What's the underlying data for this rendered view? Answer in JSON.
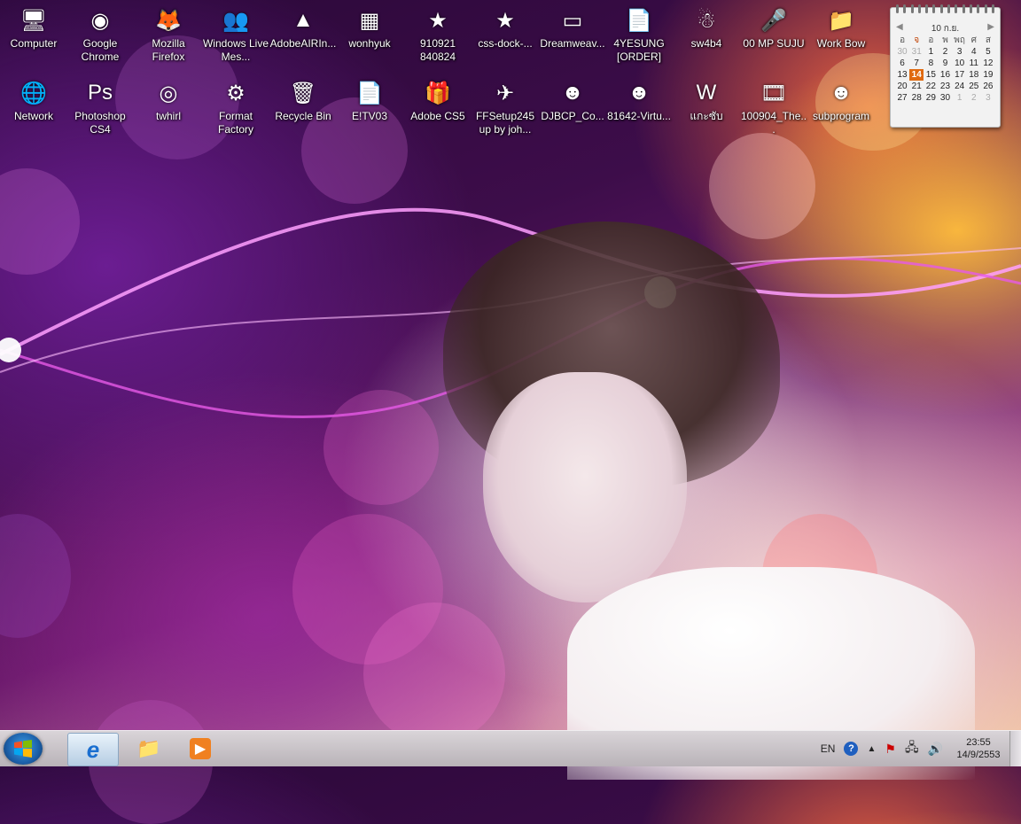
{
  "desktop": {
    "row1": [
      {
        "name": "icon-computer",
        "label": "Computer",
        "glyph": "🖥"
      },
      {
        "name": "icon-google-chrome",
        "label": "Google Chrome",
        "glyph": "◉"
      },
      {
        "name": "icon-mozilla-firefox",
        "label": "Mozilla Firefox",
        "glyph": "🦊"
      },
      {
        "name": "icon-windows-live-messenger",
        "label": "Windows Live Mes...",
        "glyph": "👥"
      },
      {
        "name": "icon-adobe-air",
        "label": "AdobeAIRIn...",
        "glyph": "▲"
      },
      {
        "name": "icon-wonhyuk",
        "label": "wonhyuk",
        "glyph": "▦"
      },
      {
        "name": "icon-910921",
        "label": "910921 840824",
        "glyph": "★"
      },
      {
        "name": "icon-css-dock",
        "label": "css-dock-...",
        "glyph": "★"
      },
      {
        "name": "icon-dreamweaver",
        "label": "Dreamweav...",
        "glyph": "▭"
      },
      {
        "name": "icon-4yesung-order",
        "label": "4YESUNG [ORDER]",
        "glyph": "📄"
      },
      {
        "name": "icon-sw4b4",
        "label": "sw4b4",
        "glyph": "☃"
      },
      {
        "name": "icon-00-mp-suju",
        "label": "00 MP SUJU",
        "glyph": "🎤"
      },
      {
        "name": "icon-work-bow",
        "label": "Work Bow",
        "glyph": "📁"
      }
    ],
    "row2": [
      {
        "name": "icon-network",
        "label": "Network",
        "glyph": "🌐"
      },
      {
        "name": "icon-photoshop-cs4",
        "label": "Photoshop CS4",
        "glyph": "Ps"
      },
      {
        "name": "icon-twhirl",
        "label": "twhirl",
        "glyph": "◎"
      },
      {
        "name": "icon-format-factory",
        "label": "Format Factory",
        "glyph": "⚙"
      },
      {
        "name": "icon-recycle-bin",
        "label": "Recycle Bin",
        "glyph": "🗑"
      },
      {
        "name": "icon-etv03",
        "label": "E!TV03",
        "glyph": "📄"
      },
      {
        "name": "icon-adobe-cs5",
        "label": "Adobe CS5",
        "glyph": "🎁"
      },
      {
        "name": "icon-ffsetup",
        "label": "FFSetup245 up by joh...",
        "glyph": "✈"
      },
      {
        "name": "icon-djbcp",
        "label": "DJBCP_Co...",
        "glyph": "☻"
      },
      {
        "name": "icon-81642-virtu",
        "label": "81642-Virtu...",
        "glyph": "☻"
      },
      {
        "name": "icon-thai-doc",
        "label": "แกะซับ",
        "glyph": "W"
      },
      {
        "name": "icon-100904",
        "label": "100904_The...",
        "glyph": "🎞"
      },
      {
        "name": "icon-subprogram",
        "label": "subprogram",
        "glyph": "☻"
      }
    ]
  },
  "calendar": {
    "month_label": "10 ก.ย.",
    "prev_arrow": "◀",
    "next_arrow": "▶",
    "weekdays": [
      "อ",
      "จ",
      "อ",
      "พ",
      "พฤ",
      "ศ",
      "ส"
    ],
    "days": [
      [
        "30",
        "31",
        "1",
        "2",
        "3",
        "4",
        "5"
      ],
      [
        "6",
        "7",
        "8",
        "9",
        "10",
        "11",
        "12"
      ],
      [
        "13",
        "14",
        "15",
        "16",
        "17",
        "18",
        "19"
      ],
      [
        "20",
        "21",
        "22",
        "23",
        "24",
        "25",
        "26"
      ],
      [
        "27",
        "28",
        "29",
        "30",
        "1",
        "2",
        "3"
      ]
    ],
    "today": "14"
  },
  "taskbar": {
    "start_label": "Start",
    "items": [
      {
        "name": "taskbar-internet-explorer",
        "glyph": "e",
        "active": true
      },
      {
        "name": "taskbar-file-explorer",
        "glyph": "📁",
        "active": false
      },
      {
        "name": "taskbar-media-player",
        "glyph": "▶",
        "active": false
      }
    ],
    "tray": {
      "language": "EN",
      "help": "?",
      "time": "23:55",
      "date": "14/9/2553"
    }
  },
  "colors": {
    "taskbar_top": "#d9d4d8",
    "calendar_today": "#e06a10"
  }
}
